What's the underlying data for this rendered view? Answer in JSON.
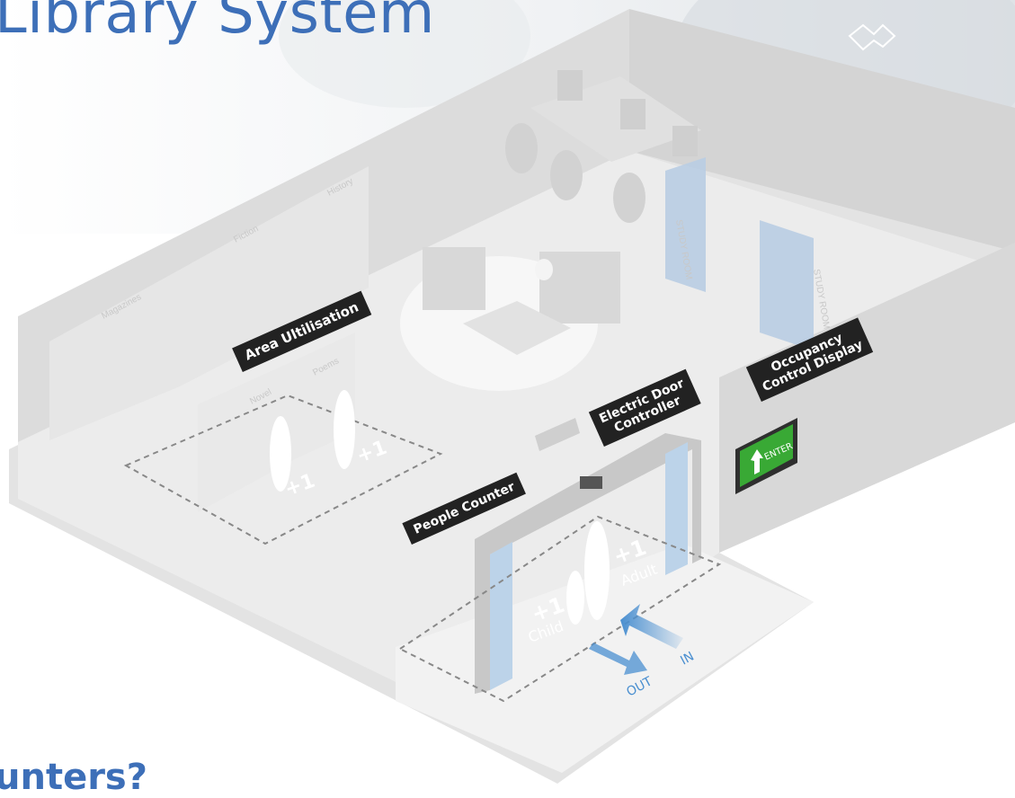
{
  "header": {
    "title": "Library System"
  },
  "footer": {
    "heading_fragment": "unters?"
  },
  "callouts": {
    "area_utilisation": "Area Ultilisation",
    "electric_door_line1": "Electric Door",
    "electric_door_line2": "Controller",
    "people_counter": "People Counter",
    "occupancy_line1": "Occupancy",
    "occupancy_line2": "Control Display"
  },
  "shelves": {
    "magazines": "Magazines",
    "fiction": "Fiction",
    "history": "History",
    "novel": "Novel",
    "poems": "Poems"
  },
  "study_rooms": {
    "room1": "STUDY ROOM",
    "room2": "STUDY ROOM"
  },
  "counts": {
    "plus_one": "+1",
    "child": "Child",
    "adult": "Adult"
  },
  "arrows": {
    "in": "IN",
    "out": "OUT"
  },
  "display": {
    "enter": "ENTER"
  },
  "colors": {
    "title_blue": "#3d6fb8",
    "arrow_blue": "#4a8fd0",
    "display_green": "#39a935",
    "callout_bg": "#222222"
  },
  "icons": {
    "corner_icon": "book-icon"
  }
}
